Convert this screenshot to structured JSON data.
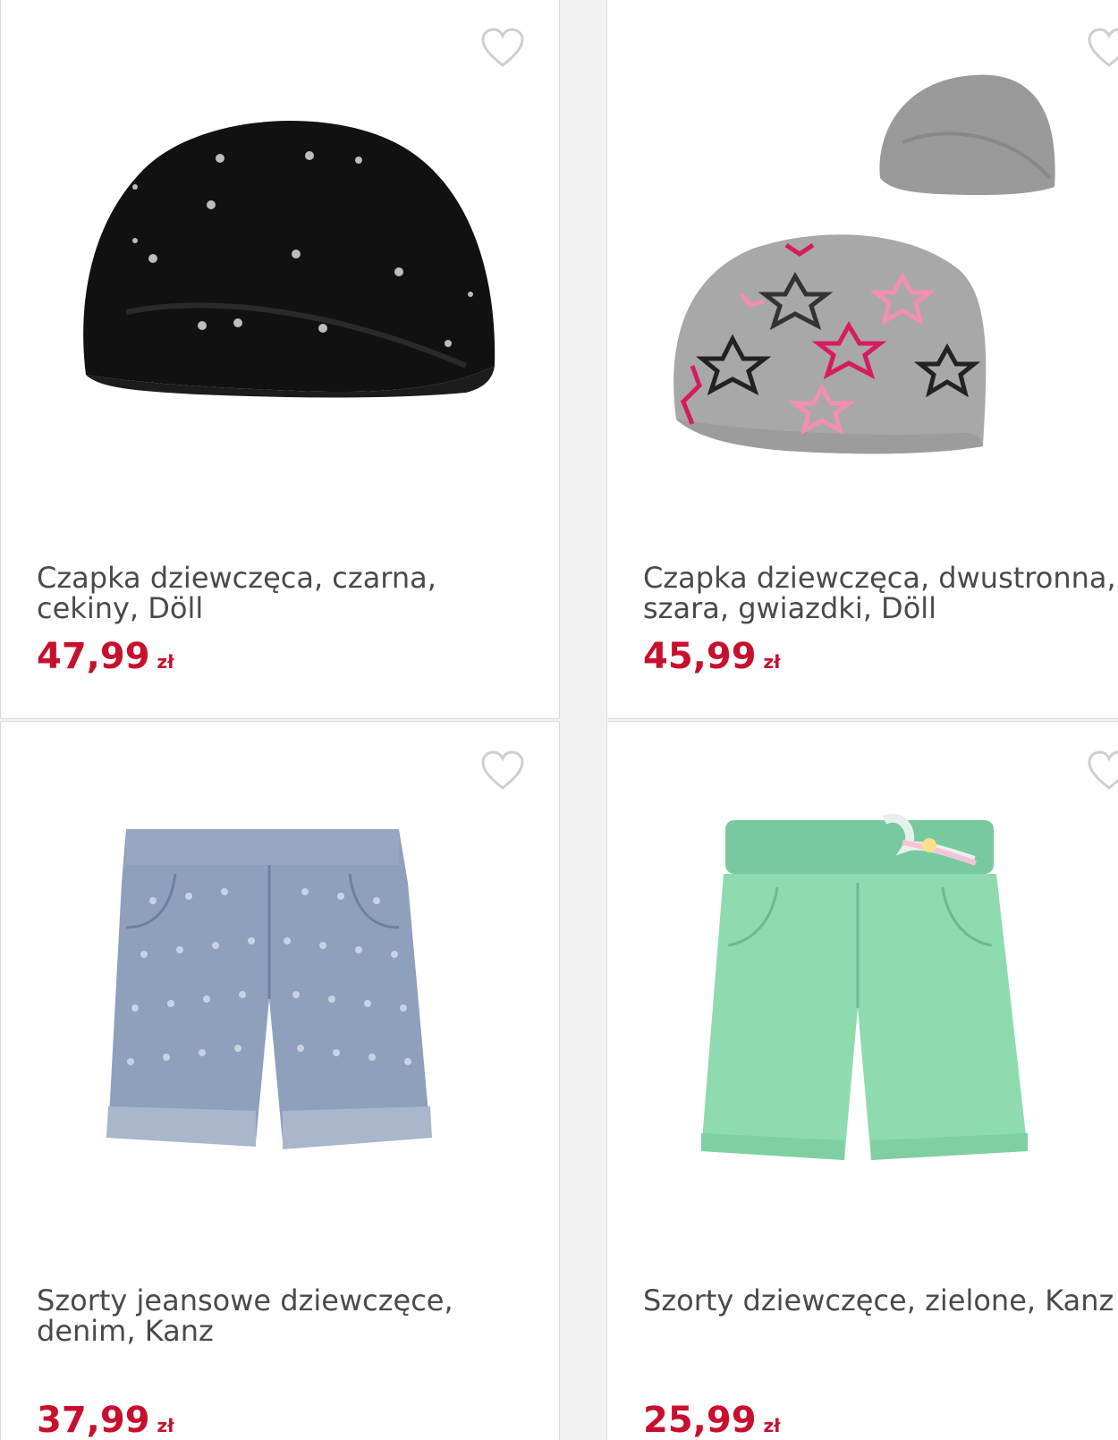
{
  "products": [
    {
      "title": "Czapka dziewczęca, czarna, cekiny, Döll",
      "price": "47,99",
      "currency": "zł",
      "image": "black-sequin-beanie"
    },
    {
      "title": "Czapka dziewczęca, dwustronna, szara, gwiazdki, Döll",
      "price": "45,99",
      "currency": "zł",
      "image": "grey-star-beanie-reversible"
    },
    {
      "title": "Szorty jeansowe dziewczęce, denim, Kanz",
      "price": "37,99",
      "currency": "zł",
      "image": "polka-dot-denim-shorts"
    },
    {
      "title": "Szorty dziewczęce, zielone, Kanz",
      "price": "25,99",
      "currency": "zł",
      "image": "green-shorts"
    }
  ],
  "icons": {
    "favorite": "heart-outline-icon"
  },
  "colors": {
    "price": "#c8102e",
    "title": "#4a4a4a",
    "icon": "#cfcfcf"
  }
}
